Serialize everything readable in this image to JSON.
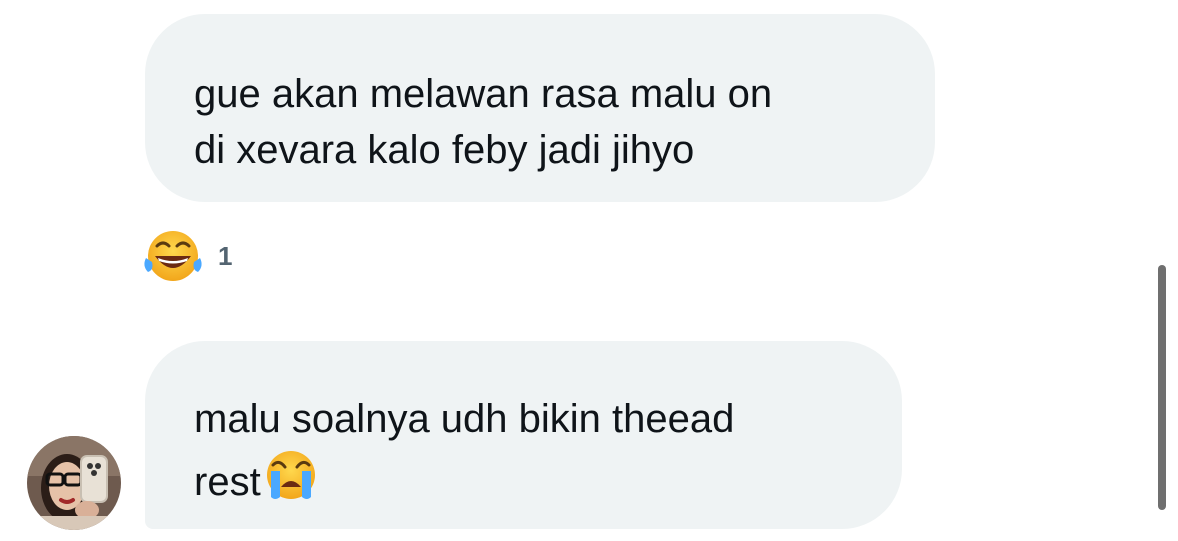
{
  "messages": [
    {
      "text": "gue akan melawan rasa malu on\ndi xevara kalo feby jadi jihyo",
      "reaction": {
        "emoji": "face-with-tears-of-joy-icon",
        "count": "1"
      }
    },
    {
      "text": "malu soalnya udh bikin theead\nrest",
      "trailing_emoji": "loudly-crying-face-icon",
      "sender_avatar": "avatar"
    }
  ],
  "colors": {
    "bubble_bg": "#eff3f4",
    "text": "#0f1419",
    "muted": "#536471",
    "scrollbar": "#6f6f6f"
  }
}
